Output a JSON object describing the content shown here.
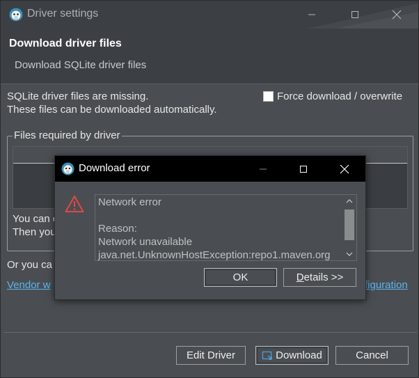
{
  "window": {
    "title": "Driver settings",
    "header_title": "Download driver files",
    "header_subtitle": "Download SQLite driver files"
  },
  "body": {
    "missing_line1": "SQLite driver files are missing.",
    "missing_line2": "These files can be downloaded automatically.",
    "force_download_label": "Force download / overwrite",
    "force_download_checked": false,
    "group_title": "Files required by driver",
    "hidden_text1": "You can c",
    "hidden_text2": "Then you",
    "or_you_text": "Or you ca",
    "vendor_link": "Vendor w",
    "config_link": "figuration"
  },
  "buttons": {
    "edit_driver": "Edit Driver",
    "download": "Download",
    "cancel": "Cancel"
  },
  "dialog": {
    "title": "Download error",
    "message_lines": [
      "Network error",
      "",
      "Reason:",
      "Network unavailable",
      "java.net.UnknownHostException:repo1.maven.org"
    ],
    "ok": "OK",
    "details_prefix": "D",
    "details_rest": "etails >>"
  },
  "colors": {
    "link": "#5ab4f0",
    "warning": "#e04848",
    "background": "#4a4e52"
  }
}
